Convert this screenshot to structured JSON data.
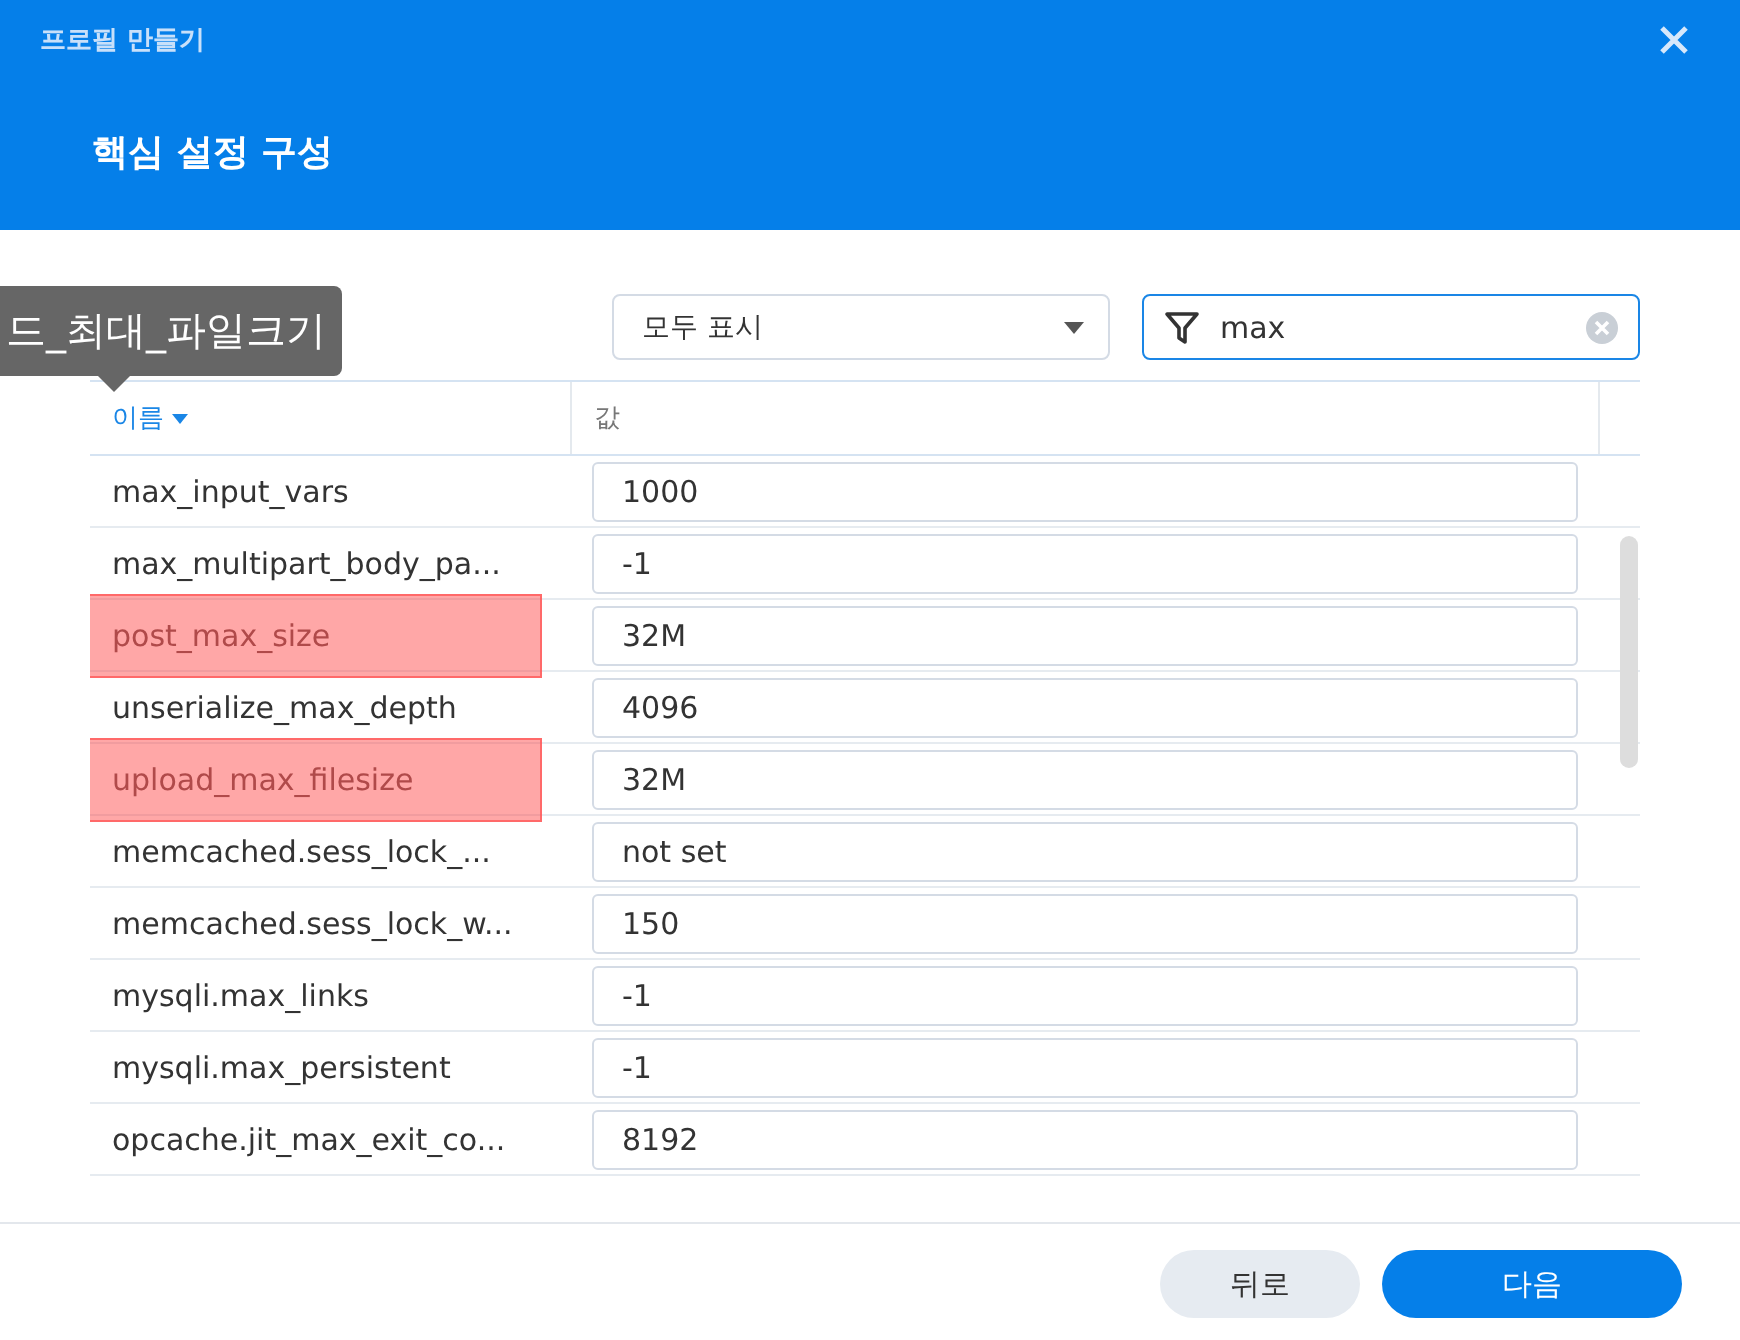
{
  "window": {
    "title": "프로필 만들기",
    "subtitle": "핵심 설정 구성"
  },
  "tooltip": "드_최대_파일크기",
  "filter": {
    "value": "모두 표시"
  },
  "search": {
    "value": "max"
  },
  "table": {
    "columns": [
      {
        "label": "이름",
        "sorted": true
      },
      {
        "label": "값",
        "sorted": false
      }
    ],
    "rows": [
      {
        "name": "max_input_vars",
        "value": "1000",
        "highlighted": false
      },
      {
        "name": "max_multipart_body_pa...",
        "value": "-1",
        "highlighted": false
      },
      {
        "name": "post_max_size",
        "value": "32M",
        "highlighted": true
      },
      {
        "name": "unserialize_max_depth",
        "value": "4096",
        "highlighted": false
      },
      {
        "name": "upload_max_filesize",
        "value": "32M",
        "highlighted": true
      },
      {
        "name": "memcached.sess_lock_...",
        "value": "not set",
        "highlighted": false
      },
      {
        "name": "memcached.sess_lock_w...",
        "value": "150",
        "highlighted": false
      },
      {
        "name": "mysqli.max_links",
        "value": "-1",
        "highlighted": false
      },
      {
        "name": "mysqli.max_persistent",
        "value": "-1",
        "highlighted": false
      },
      {
        "name": "opcache.jit_max_exit_co...",
        "value": "8192",
        "highlighted": false
      }
    ]
  },
  "buttons": [
    {
      "label": "뒤로",
      "kind": "secondary"
    },
    {
      "label": "다음",
      "kind": "primary"
    }
  ]
}
